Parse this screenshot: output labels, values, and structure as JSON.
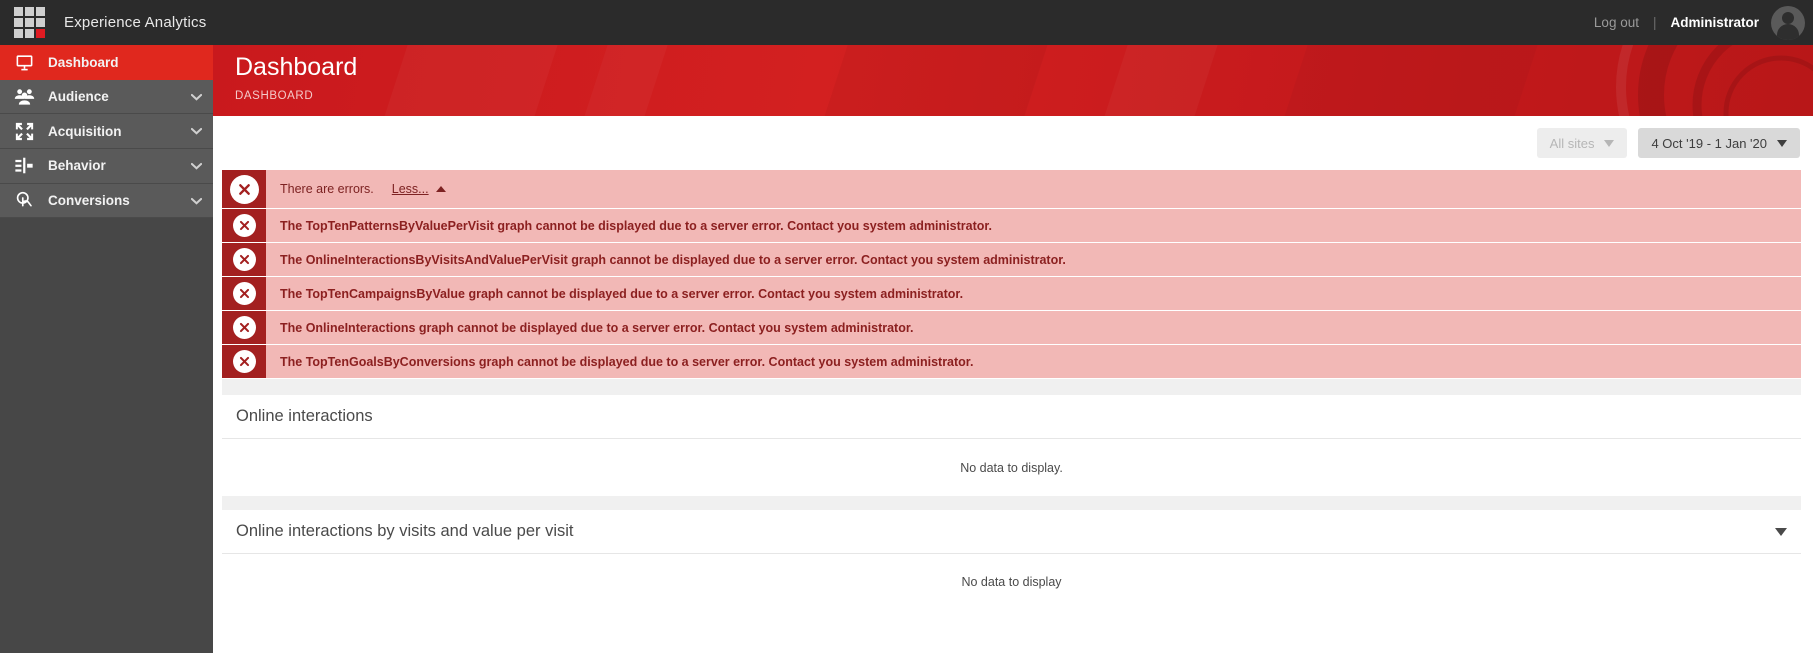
{
  "topbar": {
    "app_title": "Experience Analytics",
    "logo_icon": "grid-3x3-icon",
    "logout_label": "Log out",
    "separator": "|",
    "user_name": "Administrator",
    "avatar_icon": "user-avatar-icon"
  },
  "sidebar": {
    "items": [
      {
        "label": "Dashboard",
        "icon": "monitor-presentation-icon",
        "active": true,
        "has_chevron": false
      },
      {
        "label": "Audience",
        "icon": "people-group-icon",
        "active": false,
        "has_chevron": true
      },
      {
        "label": "Acquisition",
        "icon": "arrows-inward-icon",
        "active": false,
        "has_chevron": true
      },
      {
        "label": "Behavior",
        "icon": "flow-branch-icon",
        "active": false,
        "has_chevron": true
      },
      {
        "label": "Conversions",
        "icon": "hand-click-icon",
        "active": false,
        "has_chevron": true
      }
    ]
  },
  "page": {
    "title": "Dashboard",
    "breadcrumb": "DASHBOARD"
  },
  "filters": {
    "site_filter": {
      "label": "All sites",
      "icon": "caret-down-icon",
      "disabled": true
    },
    "date_filter": {
      "label": "4 Oct '19 - 1 Jan '20",
      "icon": "caret-down-icon",
      "disabled": false
    }
  },
  "errors": {
    "summary_text": "There are errors.",
    "toggle_label": "Less...",
    "toggle_icon": "caret-up-icon",
    "close_icon": "close-circle-icon",
    "messages": [
      "The TopTenPatternsByValuePerVisit graph cannot be displayed due to a server error. Contact you system administrator.",
      "The OnlineInteractionsByVisitsAndValuePerVisit graph cannot be displayed due to a server error. Contact you system administrator.",
      "The TopTenCampaignsByValue graph cannot be displayed due to a server error. Contact you system administrator.",
      "The OnlineInteractions graph cannot be displayed due to a server error. Contact you system administrator.",
      "The TopTenGoalsByConversions graph cannot be displayed due to a server error. Contact you system administrator."
    ]
  },
  "panels": [
    {
      "title": "Online interactions",
      "empty_text": "No data to display.",
      "has_chevron": false
    },
    {
      "title": "Online interactions by visits and value per visit",
      "empty_text": "No data to display",
      "has_chevron": true,
      "chevron_icon": "caret-down-icon"
    }
  ],
  "colors": {
    "brand_red": "#e0281e",
    "banner_red": "#c9191d",
    "error_bg": "#f2b8b6",
    "error_icon_bg": "#a32020",
    "topbar_dark": "#2b2b2b",
    "sidebar_gray": "#5a5a5a"
  }
}
